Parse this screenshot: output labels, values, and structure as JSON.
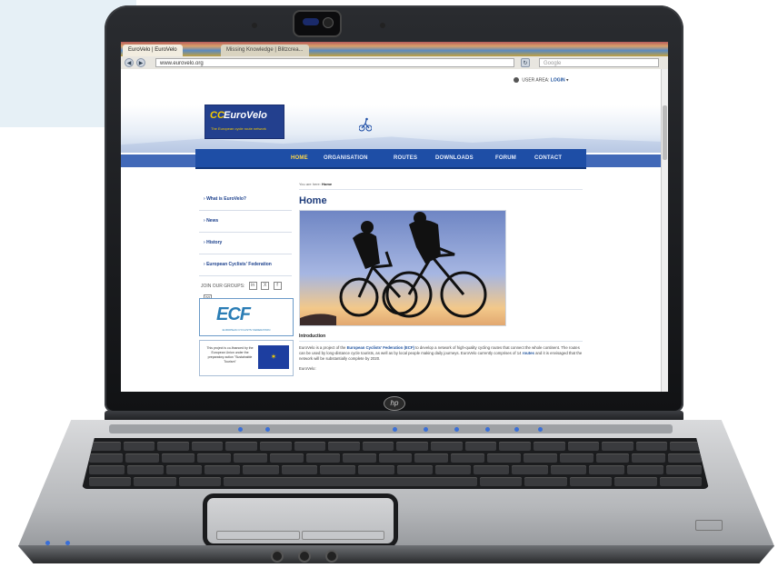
{
  "browser": {
    "tab_active": "EuroVelo | EuroVelo",
    "tab_other": "Missing Knowledge | Blitzcrea...",
    "url": "www.eurovelo.org",
    "search_placeholder": "Google"
  },
  "site": {
    "login_text": "USER AREA:",
    "login_link": "LOGIN",
    "logo": {
      "mark": "CC",
      "name": "EuroVelo",
      "tagline": "The European cycle route network"
    },
    "nav": [
      "HOME",
      "ORGANISATION",
      "ROUTES",
      "DOWNLOADS",
      "FORUM",
      "CONTACT"
    ],
    "nav_active": "HOME",
    "sidebar": [
      "What is EuroVelo?",
      "News",
      "History",
      "European Cyclists' Federation"
    ],
    "join_label": "JOIN OUR GROUPS:",
    "join_icons": [
      "in",
      "X",
      "f",
      "oo"
    ],
    "ecf": {
      "mark": "ECF",
      "subtitle": "EUROPEAN CYCLISTS' FEDERATION"
    },
    "eu_text": "This project is co-financed by the European Union under the preparatory action \"Sustainable Tourism\"",
    "breadcrumb_prefix": "You are here:",
    "breadcrumb_current": "Home",
    "page_title": "Home",
    "section_title": "Introduction",
    "intro": {
      "p1": "EuroVelo is a project of the",
      "p1_link": "European Cyclists' Federation",
      "p1_abbr": "(ECF)",
      "p2": "to develop a network of high-quality cycling routes that connect the whole continent. The routes can be used by long-distance cycle tourists, as well as by local people making daily journeys. EuroVelo currently comprises of 14",
      "routes_link": "routes",
      "p3": "and it is envisaged that the network will be substantially complete by 2020.",
      "next": "EuroVelo:"
    }
  },
  "laptop": {
    "brand_badge": "hp"
  },
  "colors": {
    "nav_bg": "#1e4ea6",
    "nav_active": "#ffd84a",
    "link": "#1a4f9c",
    "heading": "#1d3b7a"
  }
}
